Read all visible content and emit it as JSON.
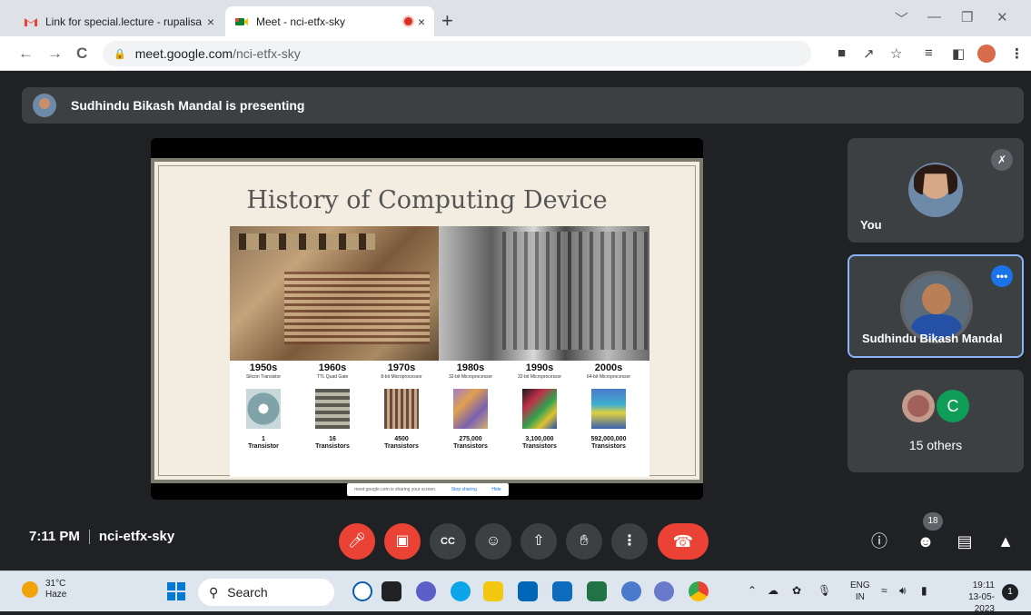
{
  "browser": {
    "tabs": [
      {
        "title": "Link for special.lecture - rupalisar",
        "close": "×",
        "icon": "gmail-icon"
      },
      {
        "title": "Meet - nci-etfx-sky",
        "close": "×",
        "icon": "google-meet-icon",
        "recording": true
      }
    ],
    "new_tab": "+",
    "window_controls": [
      "﹀",
      "—",
      "❐",
      "✕"
    ],
    "url_host": "meet.google.com",
    "url_path": "/nci-etfx-sky",
    "nav": [
      "←",
      "→",
      "C"
    ]
  },
  "meet": {
    "presenting_banner": "Sudhindu Bikash Mandal is presenting",
    "slide": {
      "title": "History of Computing Device",
      "eras": [
        {
          "decade": "1950s",
          "desc": "Silicon Transistor",
          "count": "1",
          "unit": "Transistor",
          "chip_color": "#7fa3a8"
        },
        {
          "decade": "1960s",
          "desc": "TTL Quad Gate",
          "count": "16",
          "unit": "Transistors",
          "chip_color": "#8a8a7a"
        },
        {
          "decade": "1970s",
          "desc": "8-bit Microprocessor",
          "count": "4500",
          "unit": "Transistors",
          "chip_color": "#9a7a6a"
        },
        {
          "decade": "1980s",
          "desc": "32-bit Microprocessor",
          "count": "275,000",
          "unit": "Transistors",
          "chip_color": "#a07acb"
        },
        {
          "decade": "1990s",
          "desc": "32-bit Microprocessor",
          "count": "3,100,000",
          "unit": "Transistors",
          "chip_color": "#c0304a"
        },
        {
          "decade": "2000s",
          "desc": "64-bit Microprocessor",
          "count": "592,000,000",
          "unit": "Transistors",
          "chip_color": "#4a7acb"
        }
      ]
    },
    "share_bar": {
      "text": "meet.google.com is sharing your screen.",
      "stop": "Stop sharing",
      "hide": "Hide"
    },
    "participants": {
      "you": {
        "name": "You"
      },
      "speaker": {
        "name": "Sudhindu Bikash Mandal"
      },
      "others": {
        "label": "15 others",
        "letter": "C"
      }
    },
    "time": "7:11 PM",
    "meeting_code": "nci-etfx-sky",
    "people_count": "18"
  },
  "taskbar": {
    "temp": "31°C",
    "weather": "Haze",
    "search": "Search",
    "lang_top": "ENG",
    "lang_bottom": "IN",
    "time": "19:11",
    "date": "13-05-2023",
    "notifications": "1"
  },
  "colors": {
    "accent": "#1a73e8",
    "danger": "#ea4335",
    "bg": "#202124",
    "tile": "#3c4043"
  }
}
